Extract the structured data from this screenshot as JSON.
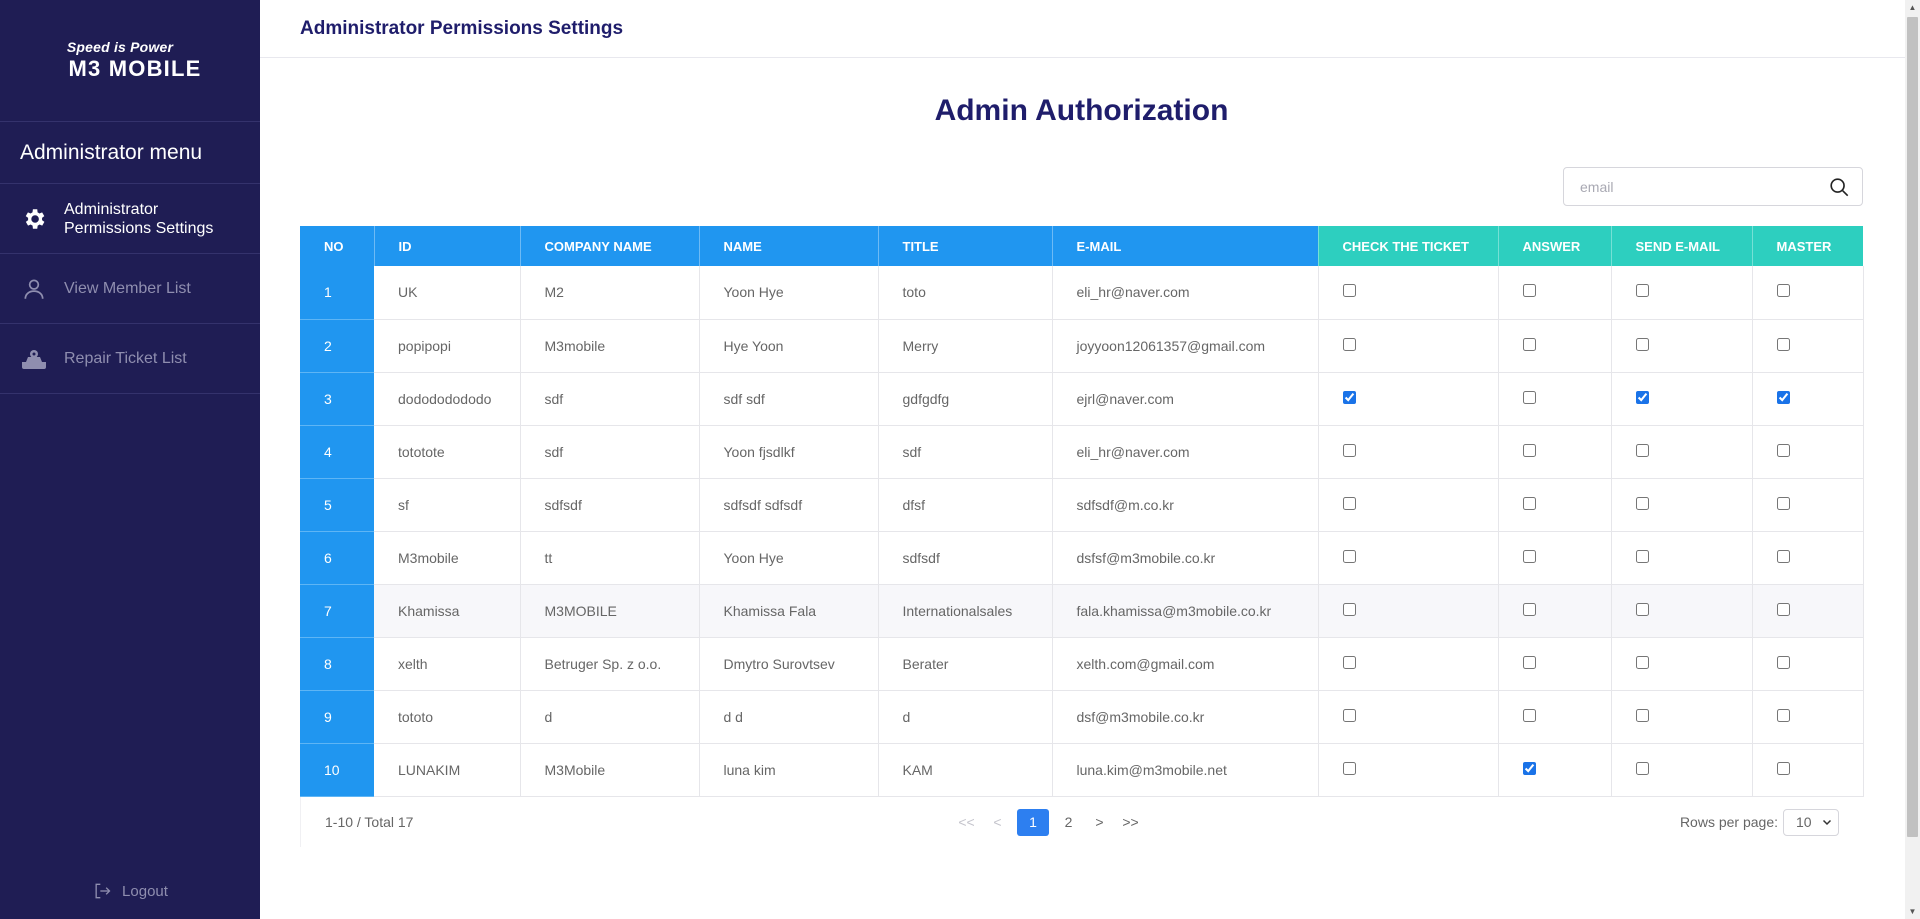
{
  "sidebar": {
    "logo_tagline": "Speed is Power",
    "logo_brand": "M3 MOBILE",
    "menu_title": "Administrator menu",
    "items": [
      {
        "label_line1": "Administrator",
        "label_line2": "Permissions Settings",
        "icon": "gear-icon",
        "active": true
      },
      {
        "label": "View Member List",
        "icon": "user-icon",
        "active": false
      },
      {
        "label": "Repair Ticket List",
        "icon": "repair-icon",
        "active": false
      }
    ],
    "logout_label": "Logout"
  },
  "header": {
    "title": "Administrator Permissions Settings"
  },
  "main": {
    "heading": "Admin Authorization",
    "search": {
      "placeholder": "email",
      "value": ""
    },
    "columns": [
      "NO",
      "ID",
      "COMPANY NAME",
      "NAME",
      "TITLE",
      "E-MAIL",
      "CHECK THE TICKET",
      "ANSWER",
      "SEND E-MAIL",
      "MASTER"
    ],
    "rows": [
      {
        "no": "1",
        "id": "UK",
        "company": "M2",
        "name": "Yoon Hye",
        "title": "toto",
        "email": "eli_hr@naver.com",
        "check_ticket": false,
        "answer": false,
        "send_email": false,
        "master": false
      },
      {
        "no": "2",
        "id": "popipopi",
        "company": "M3mobile",
        "name": "Hye Yoon",
        "title": "Merry",
        "email": "joyyoon12061357@gmail.com",
        "check_ticket": false,
        "answer": false,
        "send_email": false,
        "master": false
      },
      {
        "no": "3",
        "id": "dodododododo",
        "company": "sdf",
        "name": "sdf sdf",
        "title": "gdfgdfg",
        "email": "ejrl@naver.com",
        "check_ticket": true,
        "answer": false,
        "send_email": true,
        "master": true
      },
      {
        "no": "4",
        "id": "totototе",
        "company": "sdf",
        "name": "Yoon fjsdlkf",
        "title": "sdf",
        "email": "eli_hr@naver.com",
        "check_ticket": false,
        "answer": false,
        "send_email": false,
        "master": false
      },
      {
        "no": "5",
        "id": "sf",
        "company": "sdfsdf",
        "name": "sdfsdf sdfsdf",
        "title": "dfsf",
        "email": "sdfsdf@m.co.kr",
        "check_ticket": false,
        "answer": false,
        "send_email": false,
        "master": false
      },
      {
        "no": "6",
        "id": "M3mobile",
        "company": "tt",
        "name": "Yoon Hye",
        "title": "sdfsdf",
        "email": "dsfsf@m3mobile.co.kr",
        "check_ticket": false,
        "answer": false,
        "send_email": false,
        "master": false
      },
      {
        "no": "7",
        "id": "Khamissa",
        "company": "M3MOBILE",
        "name": "Khamissa Fala",
        "title": "Internationalsales",
        "email": "fala.khamissa@m3mobile.co.kr",
        "check_ticket": false,
        "answer": false,
        "send_email": false,
        "master": false
      },
      {
        "no": "8",
        "id": "xelth",
        "company": "Betruger Sp. z o.o.",
        "name": "Dmytro Surovtsev",
        "title": "Berater",
        "email": "xelth.com@gmail.com",
        "check_ticket": false,
        "answer": false,
        "send_email": false,
        "master": false
      },
      {
        "no": "9",
        "id": "tototo",
        "company": "d",
        "name": "d d",
        "title": "d",
        "email": "dsf@m3mobile.co.kr",
        "check_ticket": false,
        "answer": false,
        "send_email": false,
        "master": false
      },
      {
        "no": "10",
        "id": "LUNAKIM",
        "company": "M3Mobile",
        "name": "luna kim",
        "title": "KAM",
        "email": "luna.kim@m3mobile.net",
        "check_ticket": false,
        "answer": true,
        "send_email": false,
        "master": false
      }
    ],
    "pagination": {
      "range_text": "1-10 / Total 17",
      "first": "<<",
      "prev": "<",
      "pages": [
        "1",
        "2"
      ],
      "current": "1",
      "next": ">",
      "last": ">>",
      "rows_per_page_label": "Rows per page:",
      "rows_per_page_value": "10"
    }
  },
  "colors": {
    "sidebar_bg": "#1f1d54",
    "header_blue": "#2096f0",
    "header_teal": "#2dcfbf",
    "title_navy": "#1f1d6b",
    "active_page": "#2d7ff0"
  }
}
